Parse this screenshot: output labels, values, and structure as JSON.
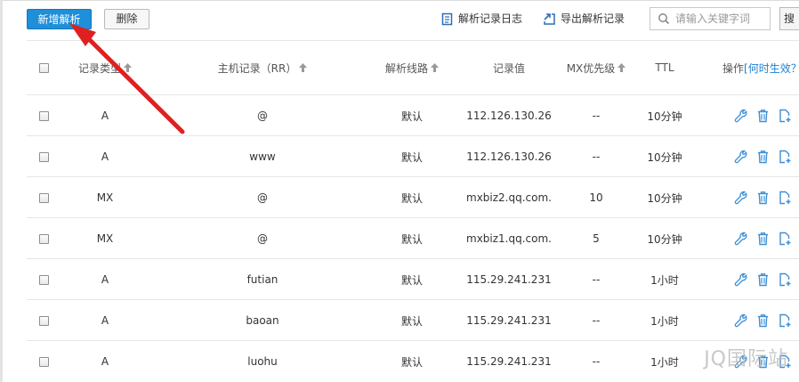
{
  "toolbar": {
    "add_label": "新增解析",
    "delete_label": "删除",
    "log_label": "解析记录日志",
    "export_label": "导出解析记录",
    "search_placeholder": "请输入关键字词",
    "search_button": "搜"
  },
  "table": {
    "headers": {
      "type": "记录类型",
      "host": "主机记录（RR）",
      "line": "解析线路",
      "value": "记录值",
      "mx": "MX优先级",
      "ttl": "TTL",
      "ops_prefix": "操作",
      "ops_link": "[何时生效？"
    },
    "rows": [
      {
        "type": "A",
        "host": "@",
        "line": "默认",
        "value": "112.126.130.26",
        "mx": "--",
        "ttl": "10分钟"
      },
      {
        "type": "A",
        "host": "www",
        "line": "默认",
        "value": "112.126.130.26",
        "mx": "--",
        "ttl": "10分钟"
      },
      {
        "type": "MX",
        "host": "@",
        "line": "默认",
        "value": "mxbiz2.qq.com.",
        "mx": "10",
        "ttl": "10分钟"
      },
      {
        "type": "MX",
        "host": "@",
        "line": "默认",
        "value": "mxbiz1.qq.com.",
        "mx": "5",
        "ttl": "10分钟"
      },
      {
        "type": "A",
        "host": "futian",
        "line": "默认",
        "value": "115.29.241.231",
        "mx": "--",
        "ttl": "1小时"
      },
      {
        "type": "A",
        "host": "baoan",
        "line": "默认",
        "value": "115.29.241.231",
        "mx": "--",
        "ttl": "1小时"
      },
      {
        "type": "A",
        "host": "luohu",
        "line": "默认",
        "value": "115.29.241.231",
        "mx": "--",
        "ttl": "1小时"
      }
    ]
  },
  "watermark": "JQ国际站",
  "colors": {
    "primary": "#1e8fd8",
    "icon_blue": "#3d8fd6",
    "arrow_red": "#e02020"
  }
}
